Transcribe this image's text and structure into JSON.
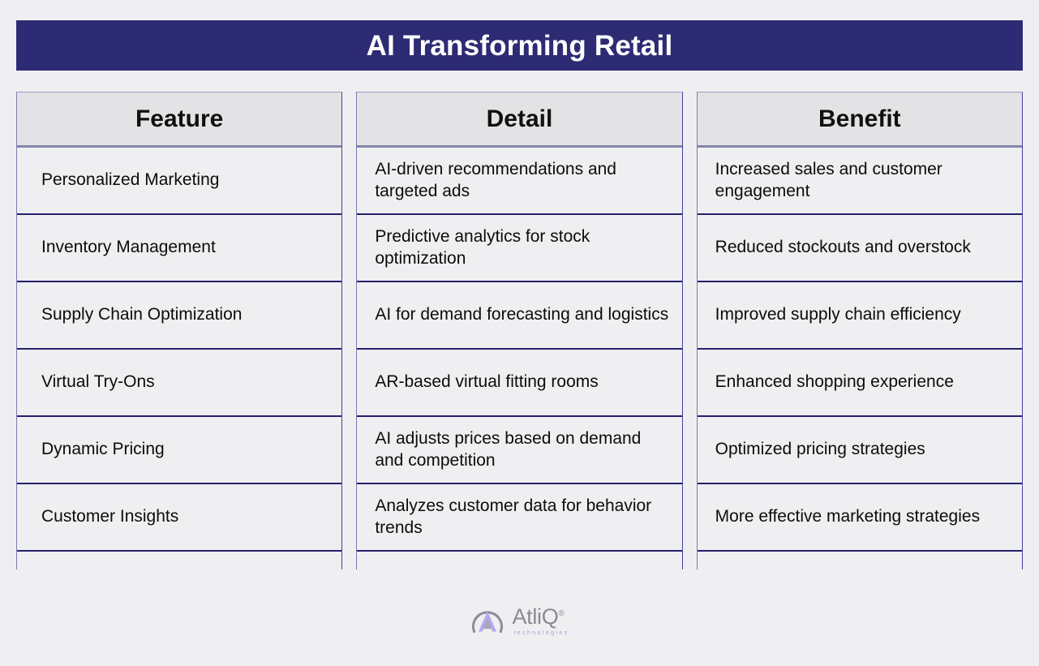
{
  "header": {
    "title": "AI Transforming Retail",
    "bar_color": "#2e2b75",
    "title_color": "#ffffff"
  },
  "page": {
    "background_color": "#efeff1",
    "border_color": "#26216e",
    "header_cell_background": "#e3e3e6",
    "cell_background": "#efeff1"
  },
  "table": {
    "columns": [
      {
        "key": "feature",
        "label": "Feature"
      },
      {
        "key": "detail",
        "label": "Detail"
      },
      {
        "key": "benefit",
        "label": "Benefit"
      }
    ],
    "rows": [
      {
        "feature": "Personalized Marketing",
        "detail": "AI-driven recommendations and targeted ads",
        "benefit": "Increased sales and customer engagement"
      },
      {
        "feature": "Inventory Management",
        "detail": "Predictive analytics for stock optimization",
        "benefit": "Reduced stockouts and overstock"
      },
      {
        "feature": "Supply Chain Optimization",
        "detail": "AI for demand forecasting and logistics",
        "benefit": "Improved supply chain efficiency"
      },
      {
        "feature": "Virtual Try-Ons",
        "detail": "AR-based virtual fitting rooms",
        "benefit": "Enhanced shopping experience"
      },
      {
        "feature": "Dynamic Pricing",
        "detail": "AI adjusts prices based on demand and competition",
        "benefit": "Optimized pricing strategies"
      },
      {
        "feature": "Customer Insights",
        "detail": "Analyzes customer data for behavior trends",
        "benefit": "More effective marketing strategies"
      }
    ]
  },
  "logo": {
    "name": "AtliQ",
    "registered_mark": "®",
    "tagline": "technologies",
    "mark_color": "#8c8c99",
    "accent_color": "#b7a6f0"
  }
}
